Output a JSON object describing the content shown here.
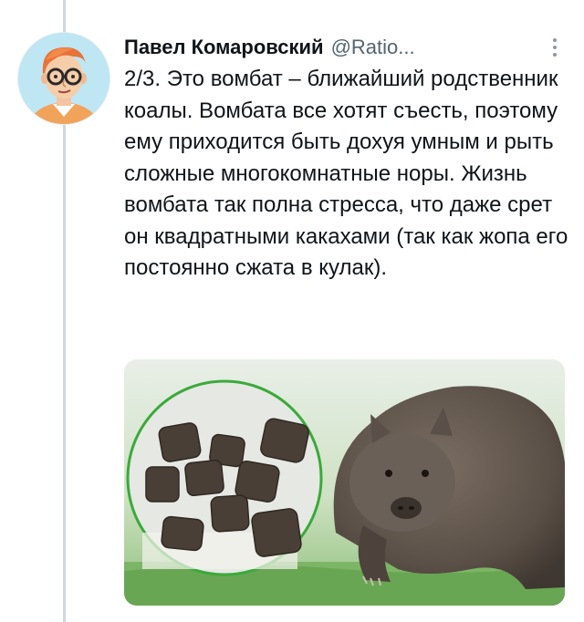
{
  "tweet": {
    "author_name": "Павел Комаровский",
    "author_handle": "@Ratio...",
    "text": "2/3. Это вомбат – ближайший родственник коалы. Вомбата все хотят съесть, поэтому ему приходится быть дохуя умным и рыть сложные многокомнатные норы. Жизнь вомбата так полна стресса, что даже срет он квадратными какахами (так как жопа его постоянно сжата в кулак).",
    "more_icon": "more-vertical-icon",
    "media_description_icon": "wombat-photo"
  },
  "colors": {
    "text": "#0f1419",
    "secondary": "#536471",
    "thread_line": "#cfd9de",
    "avatar_bg": "#bfe6f3"
  }
}
